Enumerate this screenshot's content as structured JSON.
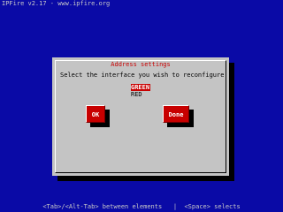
{
  "screen": {
    "title": "IPFire v2.17 - www.ipfire.org"
  },
  "dialog": {
    "title": "Address settings",
    "prompt": "Select the interface you wish to reconfigure.",
    "interfaces": [
      {
        "label": "GREEN",
        "selected": true
      },
      {
        "label": "RED",
        "selected": false
      }
    ],
    "buttons": {
      "ok": "OK",
      "done": "Done"
    }
  },
  "statusbar": {
    "text": "<Tab>/<Alt-Tab> between elements   |  <Space> selects"
  },
  "colors": {
    "background": "#0a0aa6",
    "dialog": "#c4c4c4",
    "accent": "#c80000"
  }
}
